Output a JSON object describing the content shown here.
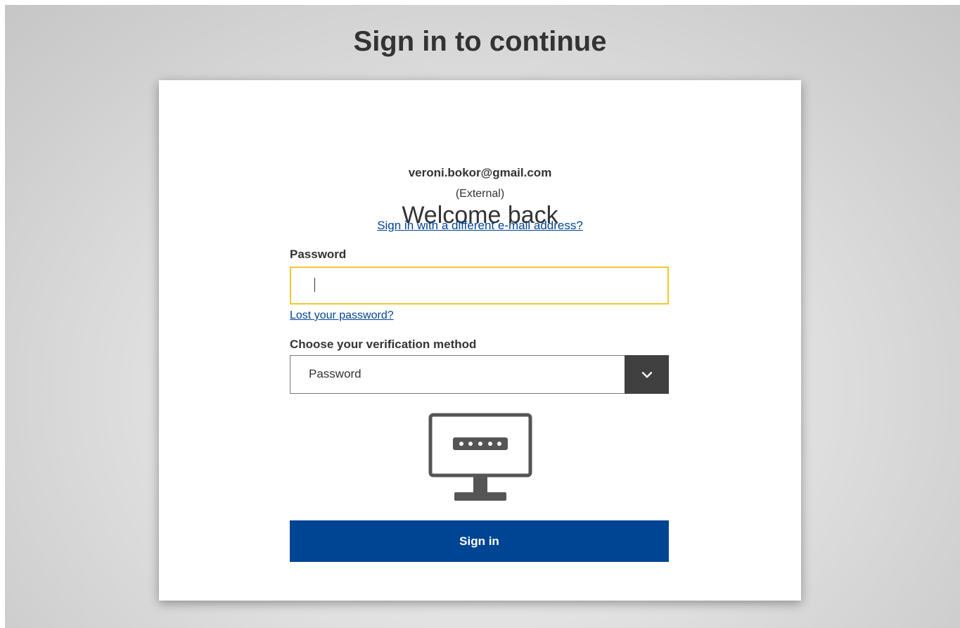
{
  "header": {
    "title": "Sign in to continue"
  },
  "card": {
    "welcome": "Welcome back",
    "email": "veroni.bokor@gmail.com",
    "account_type": "(External)",
    "different_email_link": "Sign in with a different e-mail address?",
    "password_label": "Password",
    "password_value": "",
    "lost_password_link": "Lost your password?",
    "verification_label": "Choose your verification method",
    "verification_selected": "Password",
    "monitor_icon": "monitor-password-icon",
    "submit_label": "Sign in"
  },
  "colors": {
    "primary_button": "#004494",
    "link": "#004494",
    "focus_border": "#f0c92a",
    "select_arrow_bg": "#404040",
    "text": "#333333"
  }
}
